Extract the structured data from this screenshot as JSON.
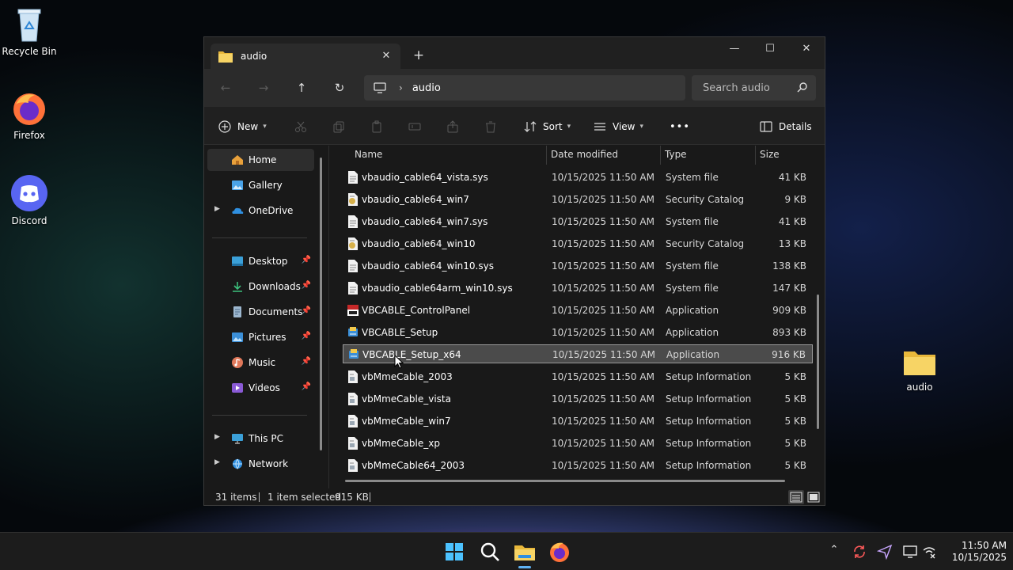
{
  "desktop": {
    "icons": [
      {
        "label": "Recycle Bin",
        "icon": "recycle-bin-icon"
      },
      {
        "label": "Firefox",
        "icon": "firefox-icon"
      },
      {
        "label": "Discord",
        "icon": "discord-icon"
      },
      {
        "label": "audio",
        "icon": "folder-icon"
      }
    ]
  },
  "window": {
    "tab_title": "audio",
    "tab_close": "✕",
    "new_tab": "+",
    "controls": {
      "minimize": "—",
      "maximize": "☐",
      "close": "✕"
    },
    "nav": {
      "back": "←",
      "forward": "→",
      "up": "↑",
      "refresh": "↻"
    },
    "address": {
      "crumb": "audio",
      "chevron": "›"
    },
    "search": {
      "placeholder": "Search audio"
    },
    "commandbar": {
      "new_label": "New",
      "sort_label": "Sort",
      "view_label": "View",
      "more_label": "•••",
      "details_label": "Details"
    },
    "sidebar": {
      "items": [
        {
          "label": "Home",
          "icon": "home-icon"
        },
        {
          "label": "Gallery",
          "icon": "gallery-icon"
        },
        {
          "label": "OneDrive",
          "icon": "onedrive-icon"
        },
        {
          "label": "Desktop",
          "icon": "desktop-icon"
        },
        {
          "label": "Downloads",
          "icon": "downloads-icon"
        },
        {
          "label": "Documents",
          "icon": "documents-icon"
        },
        {
          "label": "Pictures",
          "icon": "pictures-icon"
        },
        {
          "label": "Music",
          "icon": "music-icon"
        },
        {
          "label": "Videos",
          "icon": "videos-icon"
        },
        {
          "label": "This PC",
          "icon": "this-pc-icon"
        },
        {
          "label": "Network",
          "icon": "network-icon"
        }
      ]
    },
    "columns": {
      "name": "Name",
      "date": "Date modified",
      "type": "Type",
      "size": "Size"
    },
    "files": [
      {
        "name": "vbaudio_cable64_vista.sys",
        "date": "10/15/2025 11:50 AM",
        "type": "System file",
        "size": "41 KB",
        "icon": "system-file-icon"
      },
      {
        "name": "vbaudio_cable64_win7",
        "date": "10/15/2025 11:50 AM",
        "type": "Security Catalog",
        "size": "9 KB",
        "icon": "security-catalog-icon"
      },
      {
        "name": "vbaudio_cable64_win7.sys",
        "date": "10/15/2025 11:50 AM",
        "type": "System file",
        "size": "41 KB",
        "icon": "system-file-icon"
      },
      {
        "name": "vbaudio_cable64_win10",
        "date": "10/15/2025 11:50 AM",
        "type": "Security Catalog",
        "size": "13 KB",
        "icon": "security-catalog-icon"
      },
      {
        "name": "vbaudio_cable64_win10.sys",
        "date": "10/15/2025 11:50 AM",
        "type": "System file",
        "size": "138 KB",
        "icon": "system-file-icon"
      },
      {
        "name": "vbaudio_cable64arm_win10.sys",
        "date": "10/15/2025 11:50 AM",
        "type": "System file",
        "size": "147 KB",
        "icon": "system-file-icon"
      },
      {
        "name": "VBCABLE_ControlPanel",
        "date": "10/15/2025 11:50 AM",
        "type": "Application",
        "size": "909 KB",
        "icon": "vb-app-icon"
      },
      {
        "name": "VBCABLE_Setup",
        "date": "10/15/2025 11:50 AM",
        "type": "Application",
        "size": "893 KB",
        "icon": "setup-app-icon"
      },
      {
        "name": "VBCABLE_Setup_x64",
        "date": "10/15/2025 11:50 AM",
        "type": "Application",
        "size": "916 KB",
        "icon": "setup-app-icon",
        "selected": true
      },
      {
        "name": "vbMmeCable_2003",
        "date": "10/15/2025 11:50 AM",
        "type": "Setup Information",
        "size": "5 KB",
        "icon": "setup-info-icon"
      },
      {
        "name": "vbMmeCable_vista",
        "date": "10/15/2025 11:50 AM",
        "type": "Setup Information",
        "size": "5 KB",
        "icon": "setup-info-icon"
      },
      {
        "name": "vbMmeCable_win7",
        "date": "10/15/2025 11:50 AM",
        "type": "Setup Information",
        "size": "5 KB",
        "icon": "setup-info-icon"
      },
      {
        "name": "vbMmeCable_xp",
        "date": "10/15/2025 11:50 AM",
        "type": "Setup Information",
        "size": "5 KB",
        "icon": "setup-info-icon"
      },
      {
        "name": "vbMmeCable64_2003",
        "date": "10/15/2025 11:50 AM",
        "type": "Setup Information",
        "size": "5 KB",
        "icon": "setup-info-icon"
      }
    ],
    "status": {
      "items": "31 items",
      "selected": "1 item selected",
      "selected_size": "915 KB"
    }
  },
  "taskbar": {
    "apps": [
      "start-icon",
      "search-icon",
      "file-explorer-icon",
      "firefox-icon"
    ],
    "tray": [
      "chevron-up-icon",
      "sync-icon",
      "send-icon",
      "display-icon",
      "network-icon"
    ],
    "time": "11:50 AM",
    "date": "10/15/2025"
  },
  "colors": {
    "accent": "#5fb2f2",
    "selection": "#4b4b4b",
    "folder": "#f2c94c"
  }
}
